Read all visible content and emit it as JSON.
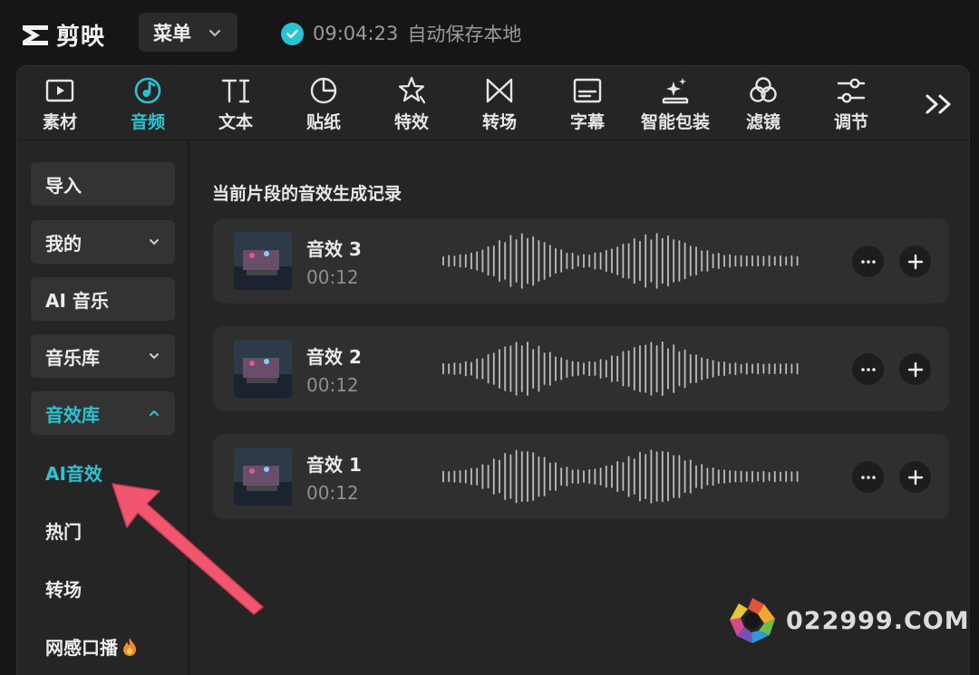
{
  "app": {
    "name": "剪映"
  },
  "topbar": {
    "menu_label": "菜单",
    "save_time": "09:04:23",
    "save_text": "自动保存本地"
  },
  "toolbar": {
    "tabs": [
      {
        "label": "素材",
        "icon": "media-play-icon"
      },
      {
        "label": "音频",
        "icon": "audio-note-icon",
        "active": true
      },
      {
        "label": "文本",
        "icon": "text-ti-icon"
      },
      {
        "label": "贴纸",
        "icon": "sticker-icon"
      },
      {
        "label": "特效",
        "icon": "effects-star-icon"
      },
      {
        "label": "转场",
        "icon": "transition-icon"
      },
      {
        "label": "字幕",
        "icon": "caption-icon"
      },
      {
        "label": "智能包装",
        "icon": "smart-package-icon"
      },
      {
        "label": "滤镜",
        "icon": "filter-icon"
      },
      {
        "label": "调节",
        "icon": "adjust-sliders-icon"
      }
    ],
    "more_icon": "double-chevron-right-icon"
  },
  "sidebar": {
    "import": "导入",
    "mine": "我的",
    "ai_music": "AI 音乐",
    "music_library": "音乐库",
    "sfx_library": "音效库",
    "sfx_sub": {
      "ai_sfx": "AI音效",
      "hot": "热门",
      "transition": "转场",
      "trending": "网感口播"
    }
  },
  "content": {
    "section_title": "当前片段的音效生成记录",
    "items": [
      {
        "name": "音效 3",
        "duration": "00:12"
      },
      {
        "name": "音效 2",
        "duration": "00:12"
      },
      {
        "name": "音效 1",
        "duration": "00:12"
      }
    ]
  },
  "watermark": {
    "text": "022999.COM"
  },
  "colors": {
    "accent": "#2bc3d1",
    "annotation_arrow": "#f0566e"
  }
}
